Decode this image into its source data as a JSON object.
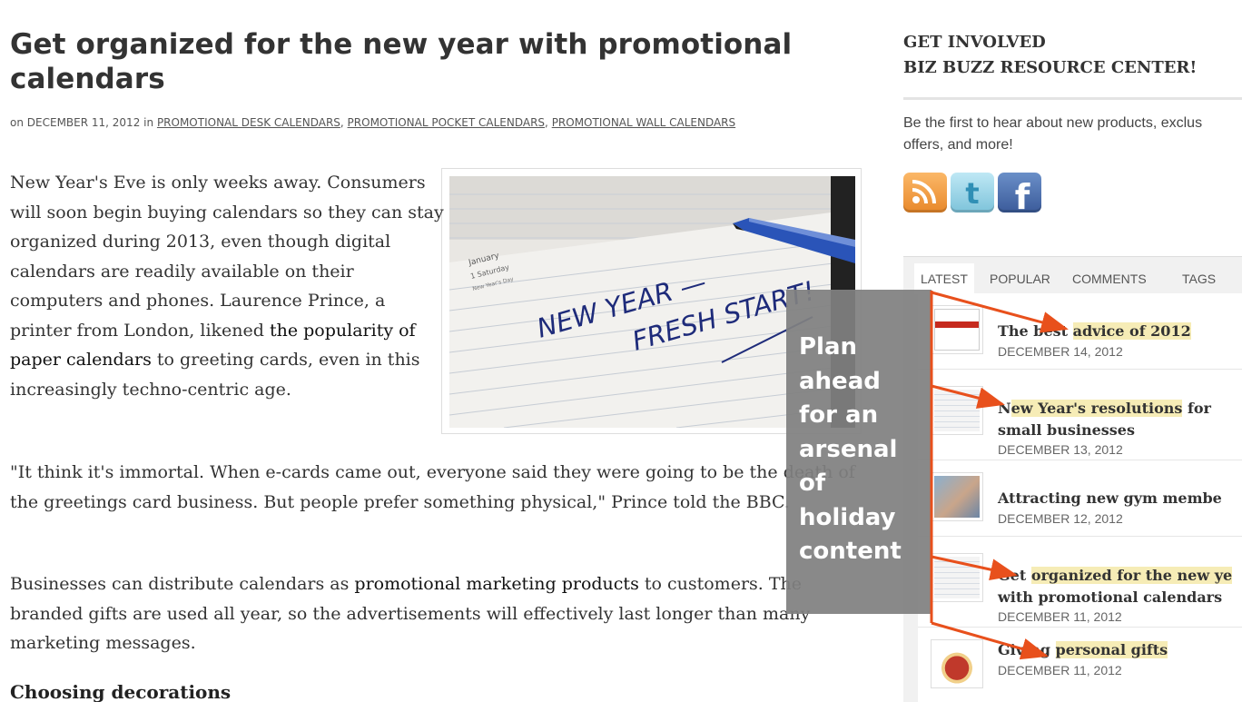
{
  "article": {
    "title": "Get organized for the new year with promotional calendars",
    "meta": {
      "on": "on",
      "date": "DECEMBER 11, 2012",
      "in": "in",
      "categories": [
        "PROMOTIONAL DESK CALENDARS",
        "PROMOTIONAL POCKET CALENDARS",
        "PROMOTIONAL WALL CALENDARS"
      ]
    },
    "image_text": {
      "month": "January",
      "day": "1 Saturday",
      "note": "New Year's Day",
      "line1": "NEW YEAR —",
      "line2": "FRESH START!"
    },
    "p1": {
      "a": "New Year's Eve is only weeks away. Consumers will soon begin buying calendars so they can stay organized during 2013, even though digital calendars are readily available on their computers and phones. Laurence Prince, a printer from London, likened ",
      "link": "the popularity of paper calendars",
      "b": " to greeting cards, even in this increasingly techno-centric age."
    },
    "p2": "\"It think it's immortal. When e-cards came out, everyone said they were going to be the death of the greetings card business. But people prefer something physical,\" Prince told the BBC.",
    "p3": {
      "a": "Businesses can distribute calendars as ",
      "link": "promotional marketing products",
      "b": " to customers. The branded gifts are used all year, so the advertisements will effectively last longer than many marketing messages."
    },
    "heading3": "Choosing decorations"
  },
  "sidebar": {
    "heading1": "GET INVOLVED",
    "heading2": "BIZ BUZZ RESOURCE CENTER!",
    "desc1": "Be the first to hear about new products, exclus",
    "desc2": "offers, and more!",
    "social": {
      "rss": "rss-icon",
      "twitter": "twitter-icon",
      "facebook": "facebook-icon",
      "twitter_glyph": "t",
      "facebook_glyph": "f"
    },
    "tabs": [
      "LATEST",
      "POPULAR",
      "COMMENTS",
      "TAGS"
    ],
    "items": [
      {
        "title_a": "The best ",
        "title_hl": "advice of 2012",
        "title_b": "",
        "title2": "",
        "date": "DECEMBER 14, 2012"
      },
      {
        "title_a": "N",
        "title_hl": "ew Year's resolutions",
        "title_b": " for",
        "title2": "small businesses",
        "date": "DECEMBER 13, 2012"
      },
      {
        "title_a": "Attracting new gym membe",
        "title_hl": "",
        "title_b": "",
        "title2": "",
        "date": "DECEMBER 12, 2012"
      },
      {
        "title_a": "Get ",
        "title_hl": "organized for the new ye",
        "title_b": "",
        "title2": "with promotional calendars",
        "date": "DECEMBER 11, 2012"
      },
      {
        "title_a": "Giving ",
        "title_hl": "personal gifts",
        "title_b": "",
        "title2": "",
        "date": "DECEMBER 11, 2012"
      }
    ]
  },
  "callout": {
    "lines": [
      "Plan",
      "ahead",
      "for an",
      "arsenal",
      "of",
      "holiday",
      "content"
    ]
  },
  "colors": {
    "arrow": "#e8501c",
    "highlight": "#f6ecb6",
    "callout_bg": "#808080"
  }
}
